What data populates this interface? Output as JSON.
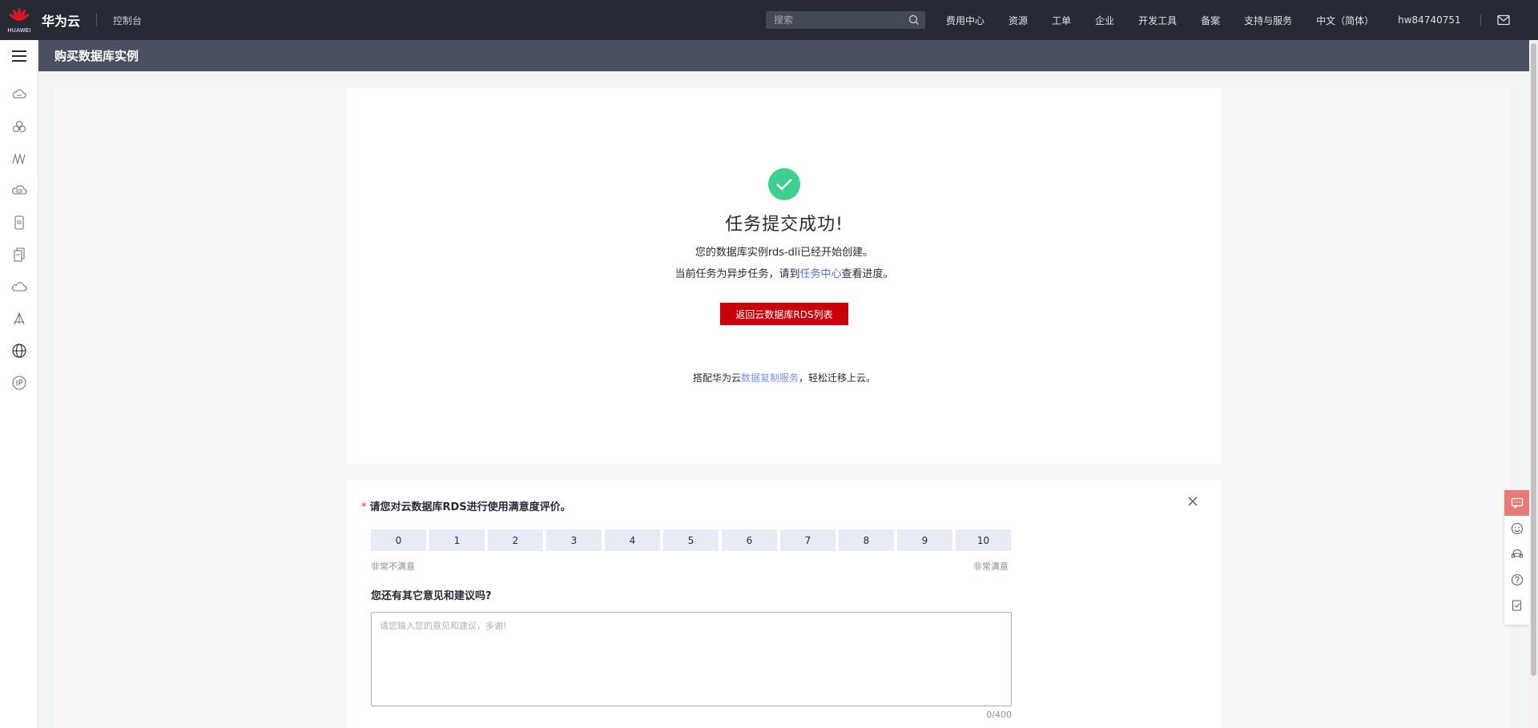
{
  "topbar": {
    "logo_text": "HUAWEI",
    "brand": "华为云",
    "console": "控制台",
    "search_placeholder": "搜索",
    "nav": [
      "费用中心",
      "资源",
      "工单",
      "企业",
      "开发工具",
      "备案",
      "支持与服务",
      "中文（简体）"
    ],
    "username": "hw84740751"
  },
  "page": {
    "title": "购买数据库实例"
  },
  "success": {
    "title": "任务提交成功!",
    "line1": "您的数据库实例rds-dli已经开始创建。",
    "line2_prefix": "当前任务为异步任务，请到",
    "line2_link": "任务中心",
    "line2_suffix": "查看进度。",
    "return_button": "返回云数据库RDS列表",
    "promo_prefix": "搭配华为云",
    "promo_link": "数据复制服务",
    "promo_suffix": "，轻松迁移上云。"
  },
  "survey": {
    "question": "请您对云数据库RDS进行使用满意度评价。",
    "required_mark": "*",
    "scores": [
      "0",
      "1",
      "2",
      "3",
      "4",
      "5",
      "6",
      "7",
      "8",
      "9",
      "10"
    ],
    "low_label": "非常不满意",
    "high_label": "非常满意",
    "question2": "您还有其它意见和建议吗?",
    "feedback_placeholder": "请您输入您的意见和建议，多谢!",
    "counter": "0/400"
  },
  "colors": {
    "topbar_bg": "#252a35",
    "header_bg": "#4a5060",
    "primary_button": "#c7000b",
    "success_green": "#3ecf8e",
    "link": "#526ecc"
  },
  "icons": {
    "sidebar": [
      "cloud-server-icon",
      "cluster-icon",
      "chart-icon",
      "cloud-container-icon",
      "database-icon",
      "document-icon",
      "cloud-icon",
      "tower-icon",
      "globe-icon",
      "ip-icon"
    ],
    "float_bar": [
      "feedback-icon",
      "smile-icon",
      "headset-icon",
      "help-icon",
      "checklist-icon"
    ]
  }
}
